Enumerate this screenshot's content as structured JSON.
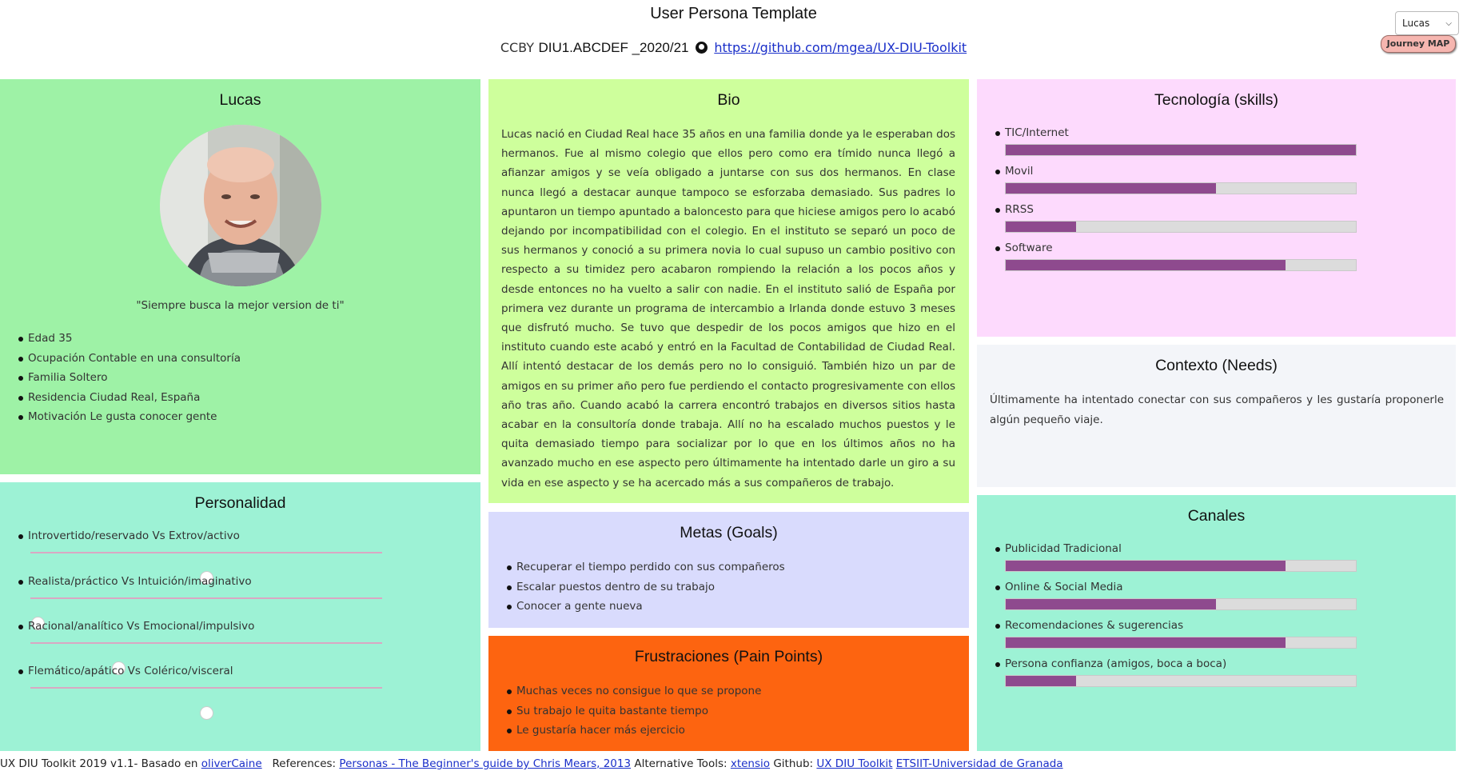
{
  "header": {
    "title": "User Persona Template",
    "license": "CCBY",
    "course": "DIU1.ABCDEF _2020/21",
    "repo_link": "https://github.com/mgea/UX-DIU-Toolkit"
  },
  "persona_select": {
    "value": "Lucas"
  },
  "journey_button": "Journey MAP",
  "profile": {
    "name": "Lucas",
    "quote": "\"Siempre busca la mejor version de ti\"",
    "details": [
      "Edad 35",
      "Ocupación Contable en una consultoría",
      "Familia Soltero",
      "Residencia Ciudad Real, España",
      "Motivación Le gusta conocer gente"
    ]
  },
  "personality": {
    "title": "Personalidad",
    "traits": [
      {
        "label": "Introvertido/reservado Vs Extrov/activo",
        "value": 0.5
      },
      {
        "label": "Realista/práctico Vs Intuición/imaginativo",
        "value": 0.02
      },
      {
        "label": "Racional/analítico Vs Emocional/impulsivo",
        "value": 0.25
      },
      {
        "label": "Flemático/apático Vs Colérico/visceral",
        "value": 0.5
      }
    ]
  },
  "bio": {
    "title": "Bio",
    "text": "Lucas nació en Ciudad Real hace 35 años en una familia donde ya le esperaban dos hermanos. Fue al mismo colegio que ellos pero como era tímido nunca llegó a afianzar amigos y se veía obligado a juntarse con sus dos hermanos. En clase nunca llegó a destacar aunque tampoco se esforzaba demasiado. Sus padres lo apuntaron un tiempo apuntado a baloncesto para que hiciese amigos pero lo acabó dejando por incompatibilidad con el colegio. En el instituto se separó un poco de sus hermanos y conoció a su primera novia lo cual supuso un cambio positivo con respecto a su timidez pero acabaron rompiendo la relación a los pocos años y desde entonces no ha vuelto a salir con nadie. En el instituto salió de España por primera vez durante un programa de intercambio a Irlanda donde estuvo 3 meses que disfrutó mucho. Se tuvo que despedir de los pocos amigos que hizo en el instituto cuando este acabó y entró en la Facultad de Contabilidad de Ciudad Real. Allí intentó destacar de los demás pero no lo consiguió. También hizo un par de amigos en su primer año pero fue perdiendo el contacto progresivamente con ellos año tras año. Cuando acabó la carrera encontró trabajos en diversos sitios hasta acabar en la consultoría donde trabaja. Allí no ha escalado muchos puestos y le quita demasiado tiempo para socializar por lo que en los últimos años no ha avanzado mucho en ese aspecto pero últimamente ha intentado darle un giro a su vida en ese aspecto y se ha acercado más a sus compañeros de trabajo."
  },
  "goals": {
    "title": "Metas (Goals)",
    "items": [
      "Recuperar el tiempo perdido con sus compañeros",
      "Escalar puestos dentro de su trabajo",
      "Conocer a gente nueva"
    ]
  },
  "frustrations": {
    "title": "Frustraciones (Pain Points)",
    "items": [
      "Muchas veces no consigue lo que se propone",
      "Su trabajo le quita bastante tiempo",
      "Le gustaría hacer más ejercicio"
    ]
  },
  "tech": {
    "title": "Tecnología (skills)",
    "items": [
      {
        "label": "TIC/Internet",
        "value": 1.0
      },
      {
        "label": "Movil",
        "value": 0.6
      },
      {
        "label": "RRSS",
        "value": 0.2
      },
      {
        "label": "Software",
        "value": 0.8
      }
    ]
  },
  "context": {
    "title": "Contexto (Needs)",
    "text": "Últimamente ha intentado conectar con sus compañeros y les gustaría proponerle algún pequeño viaje."
  },
  "channels": {
    "title": "Canales",
    "items": [
      {
        "label": "Publicidad Tradicional",
        "value": 0.8
      },
      {
        "label": "Online & Social Media",
        "value": 0.6
      },
      {
        "label": "Recomendaciones & sugerencias",
        "value": 0.8
      },
      {
        "label": "Persona confianza (amigos, boca a boca)",
        "value": 0.2
      }
    ]
  },
  "footer": {
    "prefix": "UX DIU Toolkit 2019 v1.1- Basado en",
    "link_olivercaine": "oliverCaine",
    "references_label": "References:",
    "link_persona": "Personas - The Beginner's guide by Chris Mears, 2013",
    "alt_label": "Alternative Tools:",
    "link_xtensio": "xtensio",
    "github_label": "Github:",
    "link_toolkit": "UX DIU Toolkit",
    "link_etsiit": "ETSIIT-Universidad de Granada"
  },
  "colors": {
    "profile_bg": "#9ef2a6",
    "personality_bg": "#9df2d5",
    "bio_bg": "#ceff9c",
    "goals_bg": "#d9dbfd",
    "frustrations_bg": "#fd6410",
    "tech_bg": "#fddafd",
    "context_bg": "#f3f5f9",
    "channels_bg": "#9df2d5",
    "bar_fill": "#8e4a8e"
  }
}
